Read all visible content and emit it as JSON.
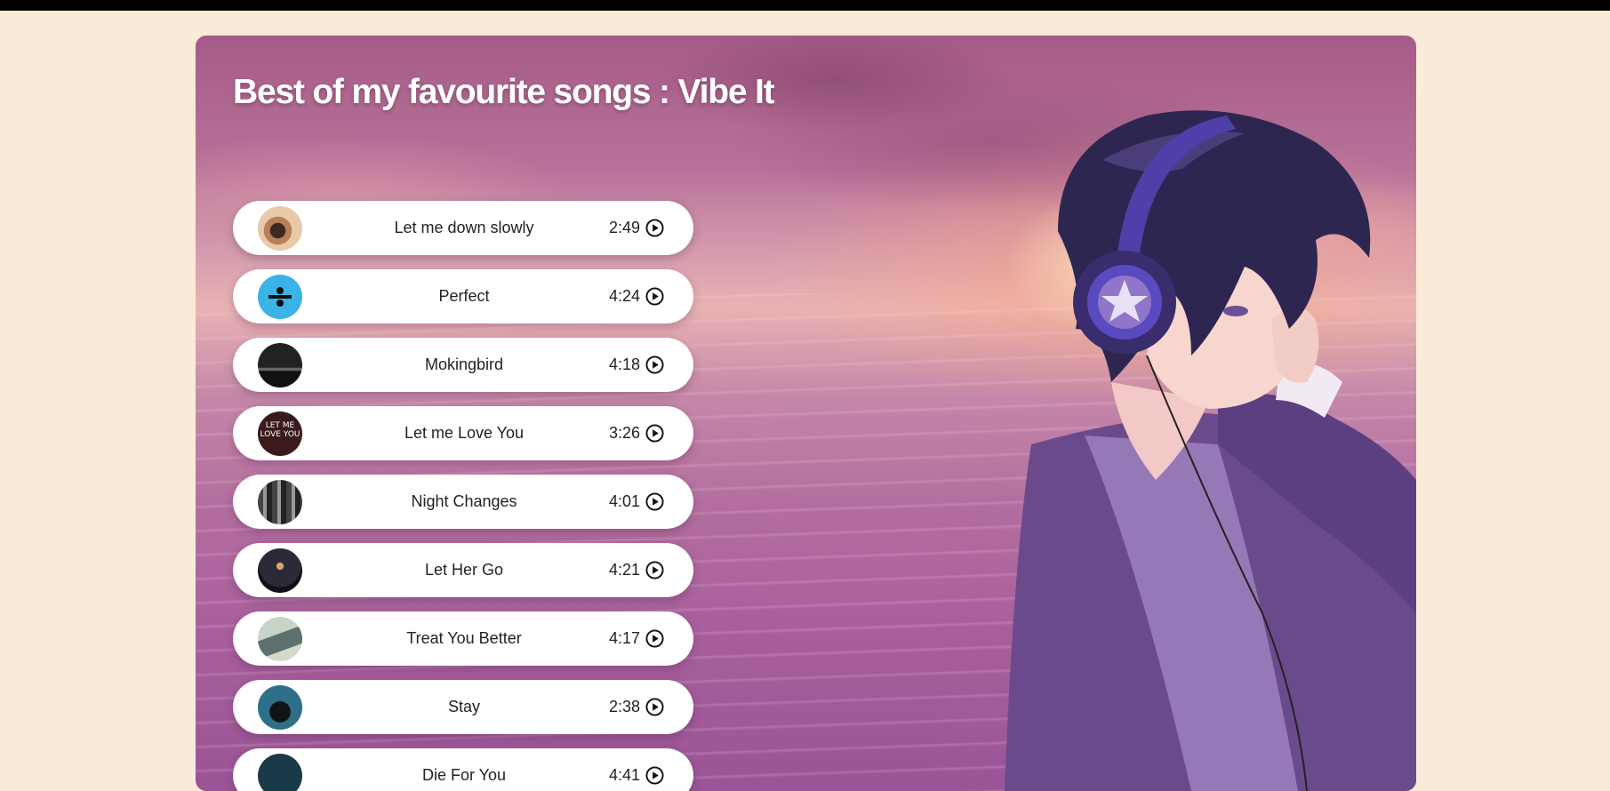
{
  "playlist": {
    "title": "Best of my favourite songs : Vibe It",
    "songs": [
      {
        "name": "Let me down slowly",
        "duration": "2:49"
      },
      {
        "name": "Perfect",
        "duration": "4:24"
      },
      {
        "name": "Mokingbird",
        "duration": "4:18"
      },
      {
        "name": "Let me Love You",
        "duration": "3:26",
        "cover_text": "LET ME LOVE YOU"
      },
      {
        "name": "Night Changes",
        "duration": "4:01"
      },
      {
        "name": "Let Her Go",
        "duration": "4:21"
      },
      {
        "name": "Treat You Better",
        "duration": "4:17"
      },
      {
        "name": "Stay",
        "duration": "2:38"
      },
      {
        "name": "Die For You",
        "duration": "4:41"
      }
    ]
  },
  "icons": {
    "play": "play-circle-icon"
  },
  "colors": {
    "page_bg": "#f9ebd7",
    "top_bar": "#000000",
    "song_card": "#ffffff",
    "title_text": "#ffffff"
  }
}
